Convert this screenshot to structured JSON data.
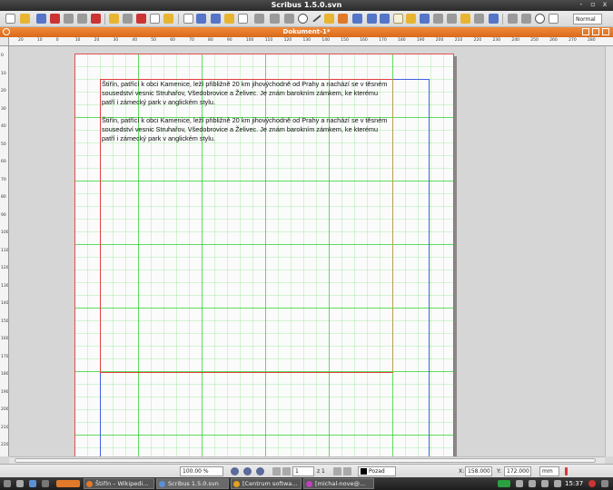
{
  "window": {
    "title": "Scribus 1.5.0.svn",
    "controls": [
      "-",
      "▫",
      "x"
    ]
  },
  "toolbar": {
    "mode_select": "Normal"
  },
  "document": {
    "title": "Dokument-1*"
  },
  "rulers": {
    "horizontal": [
      "20",
      "10",
      "0",
      "10",
      "20",
      "30",
      "40",
      "50",
      "60",
      "70",
      "80",
      "90",
      "100",
      "110",
      "120",
      "130",
      "140",
      "150",
      "160",
      "170",
      "180",
      "190",
      "200",
      "210",
      "220",
      "230",
      "240",
      "250",
      "260",
      "270",
      "280"
    ],
    "vertical": [
      "0",
      "10",
      "20",
      "30",
      "40",
      "50",
      "60",
      "70",
      "80",
      "90",
      "100",
      "110",
      "120",
      "130",
      "140",
      "150",
      "160",
      "170",
      "180",
      "190",
      "200",
      "210",
      "220",
      "230"
    ]
  },
  "text_frame": {
    "paragraphs": [
      "Štiřín, patřící k obci Kamenice, leží přibližně 20 km jihovýchodně od Prahy a nachází se v těsném sousedství vesnic Struhařov, Všedobrovice a Želivec. Je znám barokním zámkem, ke kterému patří i zámecký park v anglickém stylu.",
      "Štiřín, patřící k obci Kamenice, leží přibližně 20 km jihovýchodně od Prahy a nachází se v těsném sousedství vesnic Struhařov, Všedobrovice a Želivec. Je znám barokním zámkem, ke kterému patří i zámecký park v anglickém stylu."
    ]
  },
  "statusbar": {
    "zoom": "100.00 %",
    "page": "1",
    "page_of": "z 1",
    "layer": "Pozad",
    "x_label": "X:",
    "x_value": "158.000",
    "y_label": "Y:",
    "y_value": "172.000",
    "unit": "mm"
  },
  "taskbar": {
    "tasks": [
      {
        "label": "Štiřín – Wikipedi..."
      },
      {
        "label": "Scribus 1.5.0.svn"
      },
      {
        "label": "[Centrum softwa..."
      },
      {
        "label": "[michal-nove@..."
      }
    ],
    "clock": "15:37"
  }
}
